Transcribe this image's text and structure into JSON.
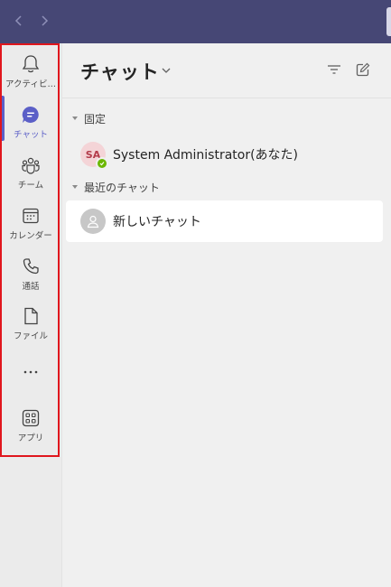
{
  "nav": {
    "back_icon": "chevron-left-icon",
    "forward_icon": "chevron-right-icon"
  },
  "rail": {
    "items": [
      {
        "label": "アクティビ…",
        "icon": "bell-icon",
        "active": false
      },
      {
        "label": "チャット",
        "icon": "chat-icon",
        "active": true
      },
      {
        "label": "チーム",
        "icon": "teams-icon",
        "active": false
      },
      {
        "label": "カレンダー",
        "icon": "calendar-icon",
        "active": false
      },
      {
        "label": "通話",
        "icon": "phone-icon",
        "active": false
      },
      {
        "label": "ファイル",
        "icon": "file-icon",
        "active": false
      },
      {
        "label": "アプリ",
        "icon": "apps-icon",
        "active": false
      }
    ],
    "more_icon": "more-icon",
    "accent_color": "#5b5fc7",
    "highlight_color": "#e0161d"
  },
  "pane": {
    "title": "チャット",
    "sections": {
      "pinned": "固定",
      "recent": "最近のチャット"
    },
    "chats": [
      {
        "initials": "SA",
        "name": "System Administrator(あなた)",
        "presence": "available"
      },
      {
        "initials": "",
        "name": "新しいチャット",
        "selected": true
      }
    ]
  },
  "colors": {
    "topbar": "#464775",
    "presence_available": "#6bb700"
  }
}
